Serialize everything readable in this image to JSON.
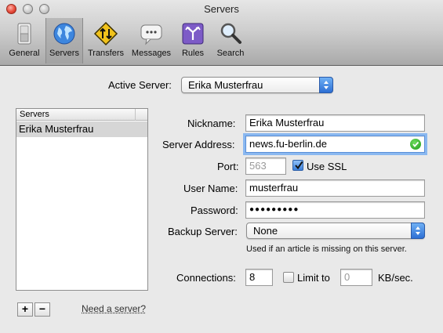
{
  "window": {
    "title": "Servers"
  },
  "toolbar": {
    "items": [
      {
        "label": "General",
        "icon": "general-switch-icon"
      },
      {
        "label": "Servers",
        "icon": "globe-icon",
        "selected": true
      },
      {
        "label": "Transfers",
        "icon": "transfers-sign-icon"
      },
      {
        "label": "Messages",
        "icon": "speech-bubble-icon"
      },
      {
        "label": "Rules",
        "icon": "rules-arrows-icon"
      },
      {
        "label": "Search",
        "icon": "magnifier-icon"
      }
    ]
  },
  "active_server": {
    "label": "Active Server:",
    "value": "Erika Musterfrau"
  },
  "server_list": {
    "header": "Servers",
    "items": [
      "Erika Musterfrau"
    ],
    "add_label": "+",
    "remove_label": "−",
    "need_server_link": "Need a server?"
  },
  "form": {
    "nickname": {
      "label": "Nickname:",
      "value": "Erika Musterfrau"
    },
    "server_address": {
      "label": "Server Address:",
      "value": "news.fu-berlin.de",
      "status_icon": "valid-check-icon"
    },
    "port": {
      "label": "Port:",
      "value": "563"
    },
    "use_ssl": {
      "label": "Use SSL",
      "checked": true
    },
    "user_name": {
      "label": "User Name:",
      "value": "musterfrau"
    },
    "password": {
      "label": "Password:",
      "value": "●●●●●●●●●"
    },
    "backup_server": {
      "label": "Backup Server:",
      "value": "None",
      "note": "Used if an article is missing on this server."
    },
    "connections": {
      "label": "Connections:",
      "value": "8"
    },
    "limit": {
      "label": "Limit to",
      "checked": false,
      "value": "0",
      "unit": "KB/sec."
    }
  },
  "colors": {
    "accent": "#3a7fdb",
    "valid": "#1f9a1a"
  }
}
